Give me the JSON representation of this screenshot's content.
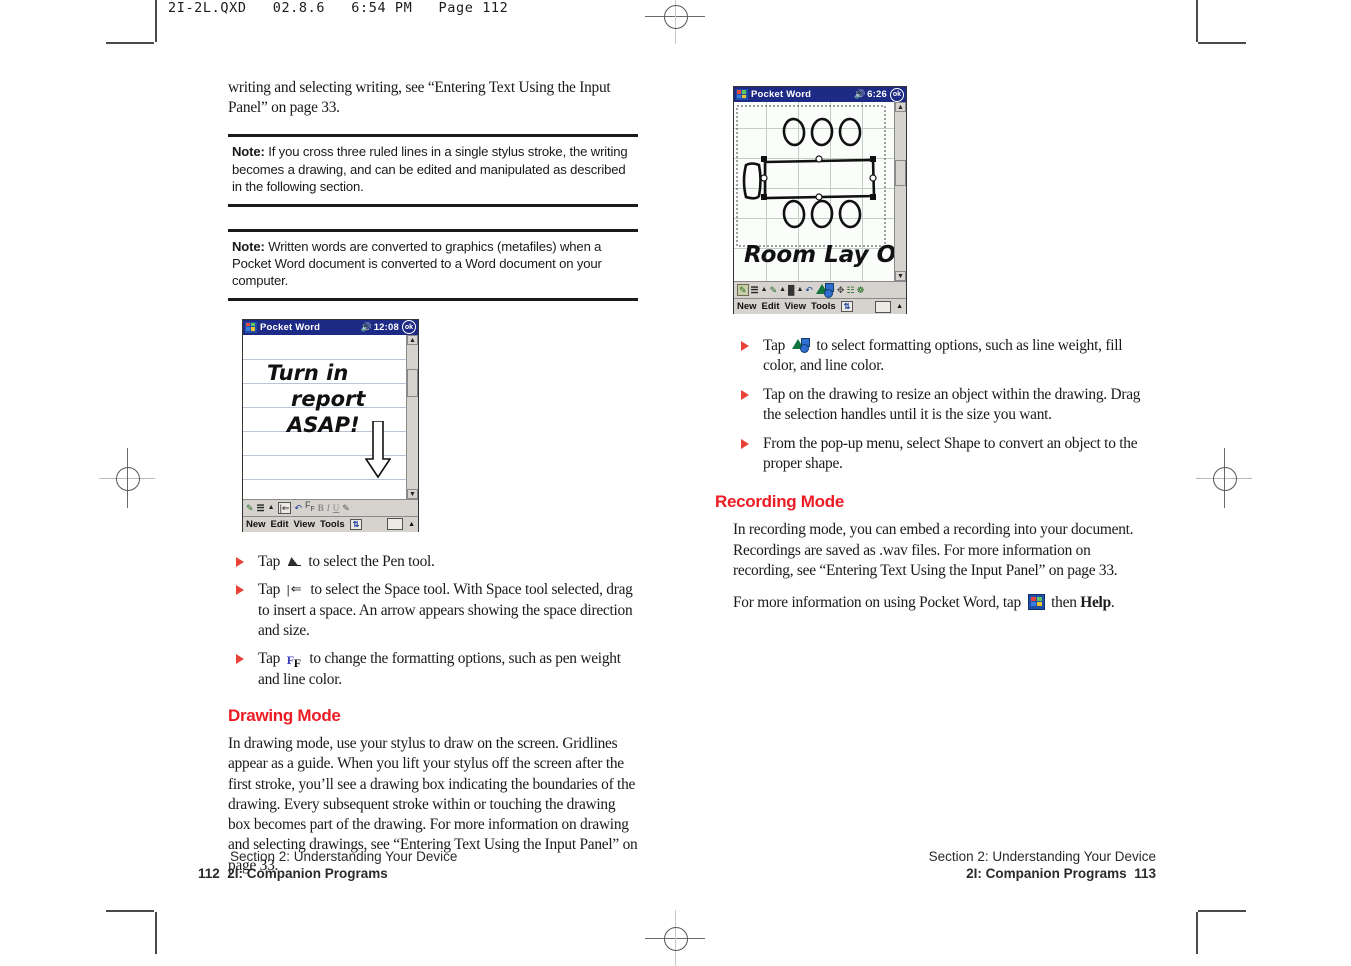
{
  "slug": "2I-2L.QXD   02.8.6   6:54 PM   Page 112",
  "colors": {
    "heading_red": "#ec1c24",
    "bullet_red": "#e8433a",
    "titlebar_blue": "#1d2b86"
  },
  "left_page": {
    "intro": "writing and selecting writing, see “Entering Text Using the Input Panel” on page 33.",
    "notes": [
      {
        "label": "Note:",
        "text": "If you cross three ruled lines in a single stylus stroke, the writing becomes a drawing, and can be edited and manipulated as described in the following section."
      },
      {
        "label": "Note:",
        "text": "Written words are converted to graphics (metafiles) when a Pocket Word document is converted to a Word document on your computer."
      }
    ],
    "screenshot": {
      "app_title": "Pocket Word",
      "time": "12:08",
      "ok_label": "ok",
      "handwriting": [
        "Turn in",
        "report",
        "ASAP!"
      ],
      "menu_items": [
        "New",
        "Edit",
        "View",
        "Tools"
      ],
      "toolbar_icons": [
        "pen-icon",
        "lines-icon",
        "dropdown-arrow-icon",
        "space-tool-icon",
        "undo-icon",
        "format-font-icon",
        "bold-icon",
        "italic-icon",
        "underline-icon",
        "highlight-icon"
      ],
      "toolbar_glyphs": [
        "✎",
        "≡",
        "▴",
        "|⇐",
        "↶",
        "F",
        "B",
        "I",
        "U",
        "✐"
      ],
      "input_panel_icon": "keyboard-icon"
    },
    "bullets": [
      {
        "pre": "Tap",
        "icon": "pen-icon",
        "post": "to select the Pen tool."
      },
      {
        "pre": "Tap",
        "icon": "space-tool-icon",
        "post": "to select the Space tool. With Space tool selected, drag to insert a space. An arrow appears showing the space direction and size."
      },
      {
        "pre": "Tap",
        "icon": "format-font-icon",
        "post": "to change the formatting options, such as pen weight and line color."
      }
    ],
    "section": {
      "heading": "Drawing Mode",
      "body": "In drawing mode, use your stylus to draw on the screen. Gridlines appear as a guide. When you lift your stylus off the screen after the first stroke, you’ll see a drawing box indicating the boundaries of the drawing. Every subsequent stroke within or touching the drawing box becomes part of the drawing. For more information on drawing and selecting drawings, see “Entering Text Using the Input Panel” on page 33."
    },
    "footer": {
      "line1": "Section 2: Understanding Your Device",
      "page_number": "112",
      "line2": "2I: Companion Programs"
    }
  },
  "right_page": {
    "screenshot": {
      "app_title": "Pocket Word",
      "time": "6:26",
      "ok_label": "ok",
      "handwriting": [
        "Room Lay Out"
      ],
      "menu_items": [
        "New",
        "Edit",
        "View",
        "Tools"
      ],
      "toolbar_icons": [
        "pen-icon",
        "lines-icon",
        "dropdown-arrow-icon",
        "line-color-icon",
        "dropdown-arrow-icon",
        "fill-color-icon",
        "dropdown-arrow-icon",
        "undo-icon",
        "format-shape-icon",
        "move-icon",
        "group-icon",
        "ungroup-icon"
      ],
      "input_panel_icon": "keyboard-icon"
    },
    "bullets": [
      {
        "pre": "Tap",
        "icon": "format-shape-icon",
        "post": "to select formatting options, such as line weight, fill color, and line color."
      },
      {
        "pre": "",
        "icon": "",
        "post": "Tap on the drawing to resize an object within the drawing. Drag the selection handles until it is the size you want."
      },
      {
        "pre": "",
        "icon": "",
        "post": "From the pop-up menu, select Shape to convert an object to the proper shape."
      }
    ],
    "section": {
      "heading": "Recording Mode",
      "body1": "In recording mode, you can embed a recording into your document. Recordings are saved as .wav files. For more information on recording, see “Entering Text Using the Input Panel” on page 33.",
      "body2_pre": "For more information on using Pocket Word, tap",
      "body2_icon": "windows-start-icon",
      "body2_mid": "then",
      "body2_bold": "Help",
      "body2_post": "."
    },
    "footer": {
      "line1": "Section 2: Understanding Your Device",
      "page_number": "113",
      "line2": "2I: Companion Programs"
    }
  }
}
